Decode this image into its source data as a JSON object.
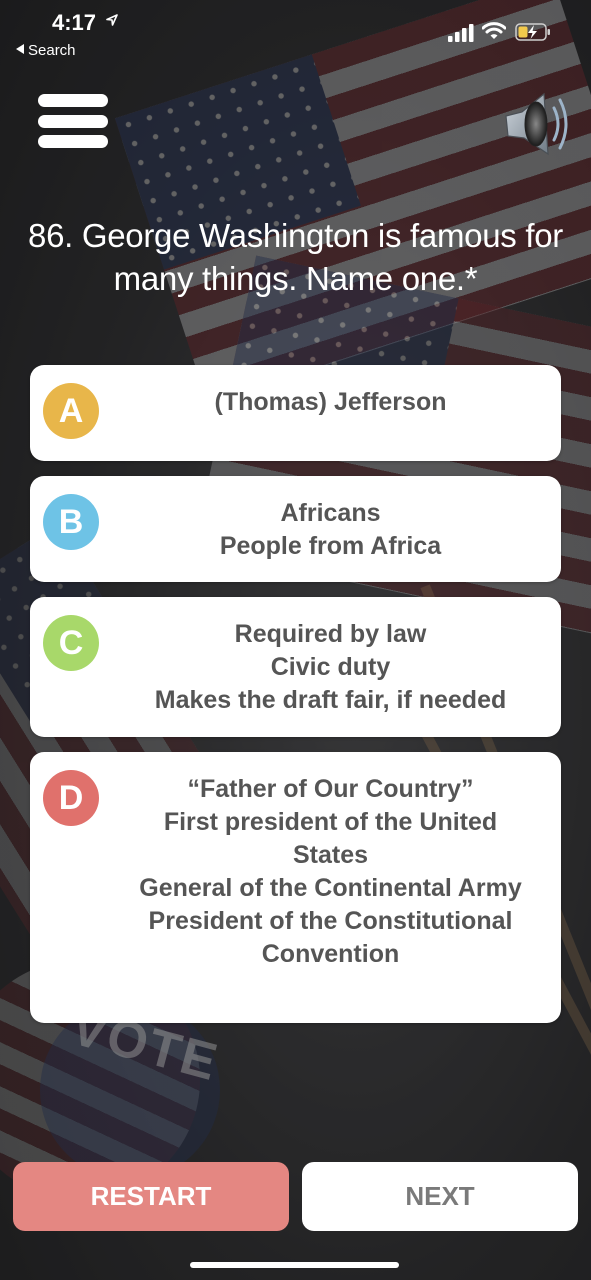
{
  "status_bar": {
    "time": "4:17",
    "back_label": "Search"
  },
  "header": {
    "menu_icon": "hamburger-menu-icon",
    "sound_icon": "speaker-volume-icon"
  },
  "question": {
    "text": "86. George Washington is famous for many things. Name one.*"
  },
  "answers": [
    {
      "letter": "A",
      "color": "#e8b64a",
      "lines": [
        "(Thomas) Jefferson"
      ]
    },
    {
      "letter": "B",
      "color": "#6ec3e6",
      "lines": [
        "Africans",
        "People from Africa"
      ]
    },
    {
      "letter": "C",
      "color": "#a8d86a",
      "lines": [
        "Required by law",
        "Civic duty",
        "Makes the draft fair, if needed"
      ]
    },
    {
      "letter": "D",
      "color": "#e0716c",
      "lines": [
        "“Father of Our Country”",
        "First president of the United",
        "States",
        "General of the Continental Army",
        "President of the Constitutional",
        "Convention"
      ]
    }
  ],
  "buttons": {
    "restart_label": "RESTART",
    "next_label": "NEXT"
  },
  "colors": {
    "restart_bg": "#e48782",
    "next_text": "#7a7a7a"
  }
}
